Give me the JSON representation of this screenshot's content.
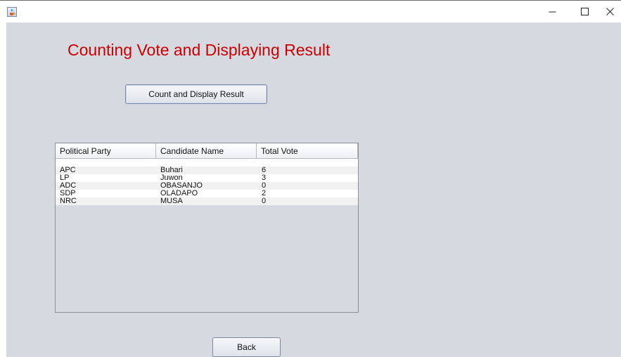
{
  "window": {
    "controls": {
      "minimize": "—",
      "maximize": "☐",
      "close": "✕"
    }
  },
  "page": {
    "heading": "Counting Vote and Displaying Result",
    "count_button_label": "Count and Display Result",
    "back_button_label": "Back"
  },
  "results_table": {
    "headers": [
      "Political Party",
      "Candidate Name",
      "Total Vote"
    ],
    "rows": [
      [
        "",
        "",
        ""
      ],
      [
        "APC",
        "Buhari",
        "6"
      ],
      [
        "LP",
        "Juwon",
        "3"
      ],
      [
        "ADC",
        "OBASANJO",
        "0"
      ],
      [
        "SDP",
        "OLADAPO",
        "2"
      ],
      [
        "NRC",
        "MUSA",
        "0"
      ]
    ]
  },
  "colors": {
    "heading": "#cc0000",
    "background": "#d6d9df"
  }
}
